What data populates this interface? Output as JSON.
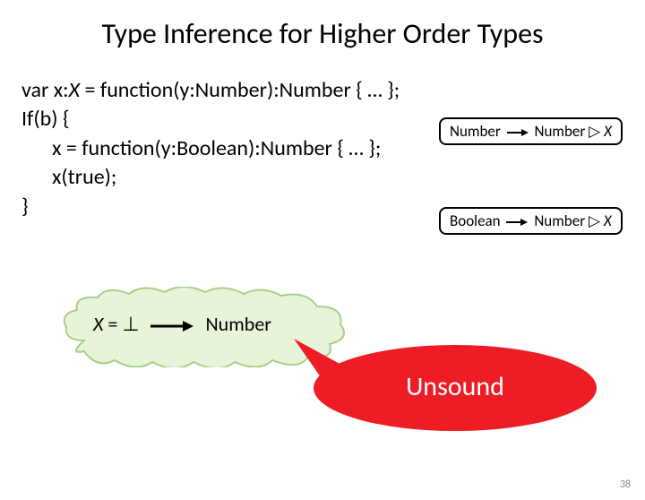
{
  "title": "Type Inference for Higher Order Types",
  "code": {
    "l1_a": "var x:",
    "l1_x": "X",
    "l1_b": " = function(y:Number):Number { … };",
    "l2": "If(b) {",
    "l3": "x = function(y:Boolean):Number { … };",
    "l4": "x(true);",
    "l5": "}"
  },
  "callouts": {
    "c1_left": "Number",
    "c1_right": "Number ▷ ",
    "c1_x": "X",
    "c2_left": "Boolean",
    "c2_right": "Number ▷ ",
    "c2_x": "X"
  },
  "cloud": {
    "lhs_x": "X",
    "lhs_rest": " = ⊥",
    "rhs": "Number"
  },
  "bubble": {
    "text": "Unsound"
  },
  "pagenum": "38"
}
